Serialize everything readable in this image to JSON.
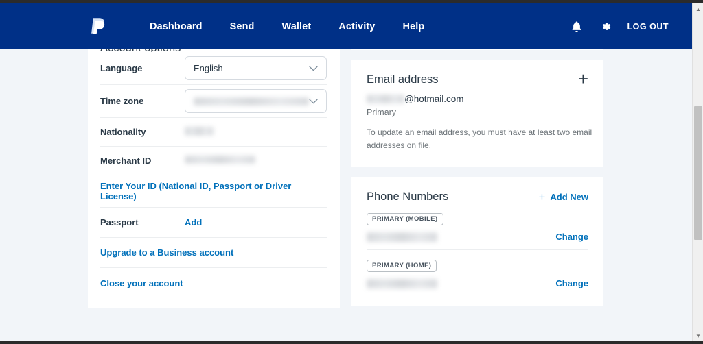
{
  "browser": {
    "scrollbar": {
      "up_arrow": "▲",
      "down_arrow": "▼"
    }
  },
  "navbar": {
    "logo": "paypal-logo",
    "links": [
      {
        "label": "Dashboard"
      },
      {
        "label": "Send"
      },
      {
        "label": "Wallet"
      },
      {
        "label": "Activity"
      },
      {
        "label": "Help"
      }
    ],
    "notifications_icon": "bell-icon",
    "settings_icon": "gear-icon",
    "logout_label": "LOG OUT",
    "background_color": "#003087"
  },
  "account_options": {
    "title": "Account options",
    "language": {
      "label": "Language",
      "value": "English",
      "chevron": "⌄"
    },
    "time_zone": {
      "label": "Time zone",
      "value": "",
      "redacted": true,
      "chevron": "⌄"
    },
    "nationality": {
      "label": "Nationality",
      "value": "",
      "redacted": true
    },
    "merchant_id": {
      "label": "Merchant ID",
      "value": "",
      "redacted": true
    },
    "enter_id_link": "Enter Your ID (National ID, Passport or Driver License)",
    "passport": {
      "label": "Passport",
      "action": "Add"
    },
    "upgrade_link": "Upgrade to a Business account",
    "close_account_link": "Close your account"
  },
  "email_card": {
    "title": "Email address",
    "add_icon": "plus-icon",
    "address_suffix": "@hotmail.com",
    "address_redacted": true,
    "primary_label": "Primary",
    "note": "To update an email address, you must have at least two email addresses on file."
  },
  "phone_card": {
    "title": "Phone Numbers",
    "add_new": {
      "plus": "+",
      "label": "Add New"
    },
    "numbers": [
      {
        "badge": "PRIMARY (MOBILE)",
        "value": "",
        "redacted": true,
        "action": "Change"
      },
      {
        "badge": "PRIMARY (HOME)",
        "value": "",
        "redacted": true,
        "action": "Change"
      }
    ]
  },
  "colors": {
    "navy": "#003087",
    "link_blue": "#0070ba",
    "page_bg": "#f2f5f9",
    "card_bg": "#ffffff",
    "text_dark": "#2b3a47"
  }
}
